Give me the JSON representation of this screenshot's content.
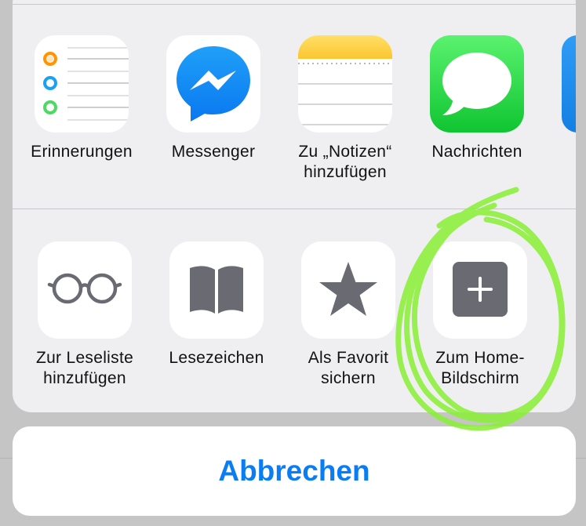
{
  "share_apps": [
    {
      "label": "Erinnerungen",
      "icon": "reminders-icon"
    },
    {
      "label": "Messenger",
      "icon": "messenger-icon"
    },
    {
      "label": "Zu „Notizen“\nhinzufügen",
      "icon": "notes-icon"
    },
    {
      "label": "Nachrichten",
      "icon": "messages-icon"
    }
  ],
  "actions": [
    {
      "label": "Zur Leseliste\nhinzufügen",
      "icon": "glasses-icon"
    },
    {
      "label": "Lesezeichen",
      "icon": "book-icon"
    },
    {
      "label": "Als Favorit\nsichern",
      "icon": "star-icon"
    },
    {
      "label": "Zum Home-\nBildschirm",
      "icon": "add-square-icon"
    }
  ],
  "cancel_label": "Abbrechen",
  "colors": {
    "accent": "#0a7df4",
    "highlight": "#8cf03a",
    "sheet_background": "#efeff1",
    "icon_gray": "#6a6a73"
  }
}
